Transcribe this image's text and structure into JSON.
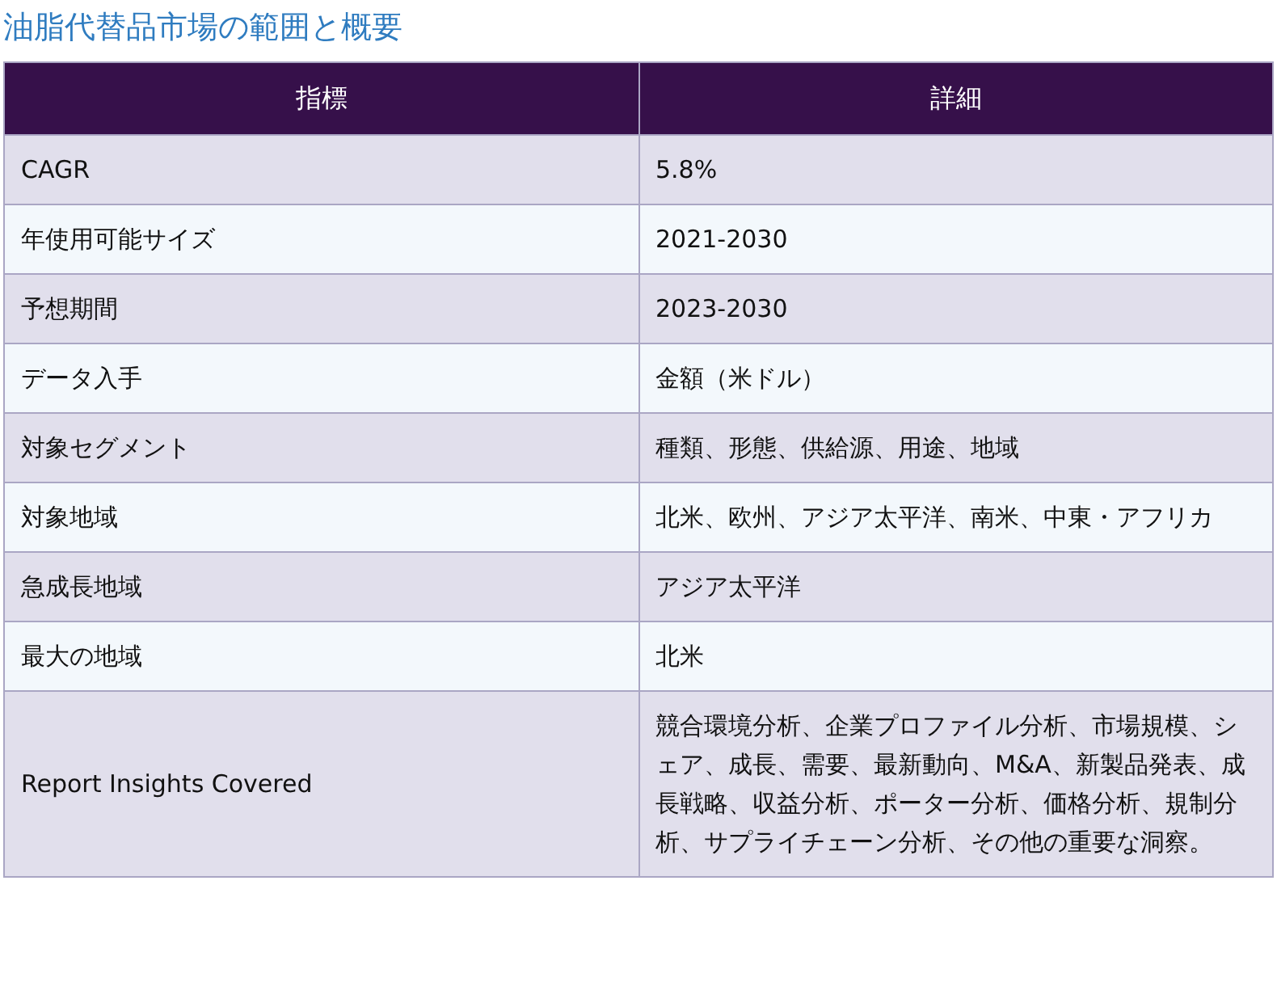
{
  "title": "油脂代替品市場の範囲と概要",
  "table": {
    "columns": [
      "指標",
      "詳細"
    ],
    "rows": [
      [
        "CAGR",
        "5.8%"
      ],
      [
        "年使用可能サイズ",
        "2021-2030"
      ],
      [
        "予想期間",
        "2023-2030"
      ],
      [
        "データ入手",
        "金額（米ドル）"
      ],
      [
        "対象セグメント",
        "種類、形態、供給源、用途、地域"
      ],
      [
        "対象地域",
        "北米、欧州、アジア太平洋、南米、中東・アフリカ"
      ],
      [
        "急成長地域",
        "アジア太平洋"
      ],
      [
        "最大の地域",
        "北米"
      ],
      [
        "Report Insights Covered",
        "競合環境分析、企業プロファイル分析、市場規模、シェア、成長、需要、最新動向、M&A、新製品発表、成長戦略、収益分析、ポーター分析、価格分析、規制分析、サプライチェーン分析、その他の重要な洞察。"
      ]
    ]
  }
}
